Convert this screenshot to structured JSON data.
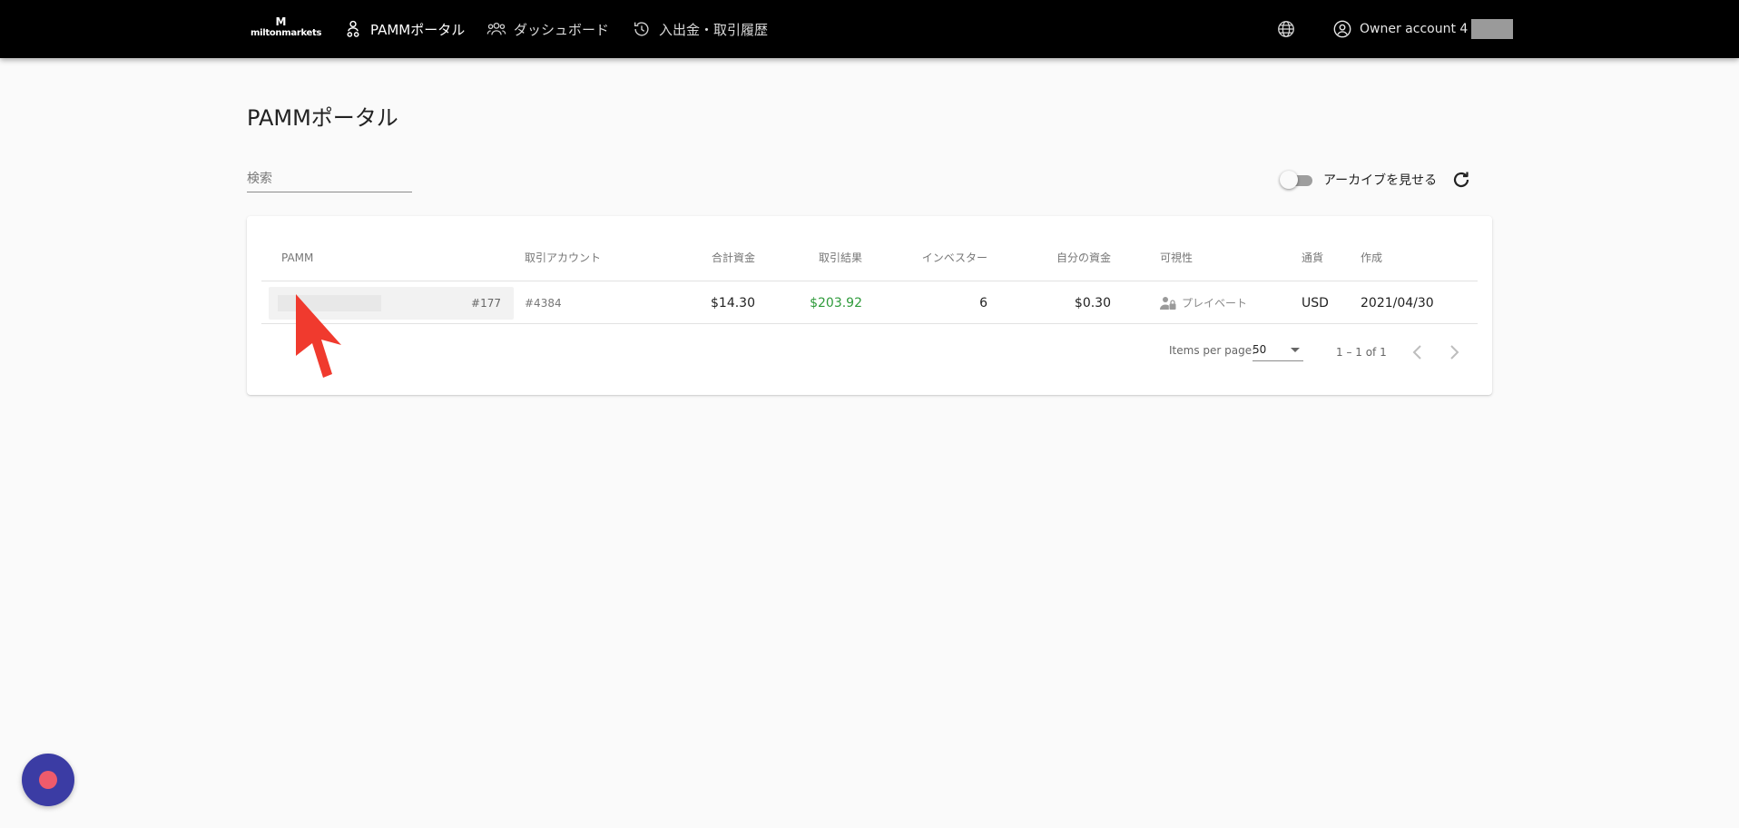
{
  "header": {
    "logo_mark": "M",
    "logo_text": "miltonmarkets",
    "nav": [
      {
        "label": "PAMMポータル",
        "icon": "pamm-user-icon",
        "active": true
      },
      {
        "label": "ダッシュボード",
        "icon": "group-icon",
        "active": false
      },
      {
        "label": "入出金・取引履歴",
        "icon": "history-icon",
        "active": false
      }
    ],
    "language_icon": "globe-icon",
    "account_label": "Owner account 4"
  },
  "page": {
    "title": "PAMMポータル",
    "search_placeholder": "検索",
    "archive_toggle_label": "アーカイブを見せる",
    "archive_toggle_on": false
  },
  "table": {
    "columns": [
      "PAMM",
      "取引アカウント",
      "合計資金",
      "取引結果",
      "インベスター",
      "自分の資金",
      "可視性",
      "通貨",
      "作成"
    ],
    "rows": [
      {
        "pamm_id": "#177",
        "trading_account": "#4384",
        "total_funds": "$14.30",
        "trading_result": "$203.92",
        "investors": "6",
        "own_funds": "$0.30",
        "visibility": "プレイベート",
        "currency": "USD",
        "created": "2021/04/30"
      }
    ]
  },
  "pagination": {
    "items_per_page_label": "Items per page:",
    "items_per_page_value": "50",
    "range": "1 – 1 of 1"
  },
  "colors": {
    "topbar": "#000000",
    "positive": "#2e9a3a",
    "arrow": "#f03a2e",
    "chat_button": "#3b3ca4",
    "chat_dot": "#ee5b6c"
  }
}
